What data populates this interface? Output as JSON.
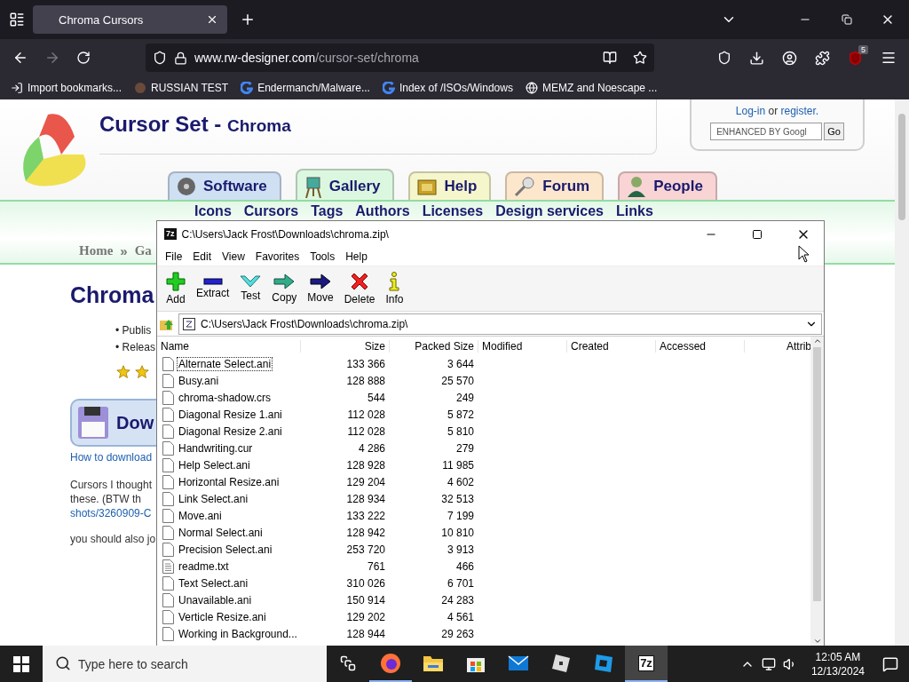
{
  "browser": {
    "tabs": [
      {
        "title": "Chroma Cursors",
        "selected": true
      }
    ],
    "url": {
      "domain": "www.rw-designer.com",
      "path": "/cursor-set/chroma"
    },
    "extensions_badge": "5",
    "bookmarks": [
      {
        "label": "Import bookmarks..."
      },
      {
        "label": "RUSSIAN TEST"
      },
      {
        "label": "Endermanch/Malware..."
      },
      {
        "label": "Index of /ISOs/Windows"
      },
      {
        "label": "MEMZ and Noescape ..."
      }
    ]
  },
  "page": {
    "site_title": "Cursor Set -",
    "site_subtitle": "Chroma",
    "login": {
      "link": "Log-in",
      "or": "or",
      "register": "register."
    },
    "search": {
      "placeholder": "ENHANCED BY Googl",
      "button": "Go"
    },
    "nav_tabs": [
      {
        "label": "Software",
        "selected": false,
        "color": "#cfe0f3"
      },
      {
        "label": "Gallery",
        "selected": true,
        "color": "#dcf7e0"
      },
      {
        "label": "Help",
        "selected": false,
        "color": "#f6f6cc"
      },
      {
        "label": "Forum",
        "selected": false,
        "color": "#fde7cc"
      },
      {
        "label": "People",
        "selected": false,
        "color": "#f8d4d4"
      }
    ],
    "sub_nav": [
      "Icons",
      "Cursors",
      "Tags",
      "Authors",
      "Licenses",
      "Design services",
      "Links"
    ],
    "breadcrumb": {
      "home": "Home",
      "separator": "»",
      "current": "Ga"
    },
    "heading": "Chroma",
    "details": [
      {
        "marker": "•",
        "text": "Publis"
      },
      {
        "marker": "•",
        "text": "Releas"
      }
    ],
    "download": "Dow",
    "how_to": "How to download",
    "description": [
      {
        "text": "Cursors I thought",
        "kind": "text"
      },
      {
        "text": "these. (BTW  th",
        "kind": "text"
      },
      {
        "text": "shots/3260909-C",
        "kind": "link"
      }
    ],
    "note": "you should also jo"
  },
  "archiver": {
    "title": "C:\\Users\\Jack Frost\\Downloads\\chroma.zip\\",
    "icon_label": "7z",
    "menu": [
      "File",
      "Edit",
      "View",
      "Favorites",
      "Tools",
      "Help"
    ],
    "toolbar": [
      "Add",
      "Extract",
      "Test",
      "Copy",
      "Move",
      "Delete",
      "Info"
    ],
    "address": "C:\\Users\\Jack Frost\\Downloads\\chroma.zip\\",
    "columns": [
      "Name",
      "Size",
      "Packed Size",
      "Modified",
      "Created",
      "Accessed",
      "Attrib"
    ],
    "rows": [
      {
        "name": "Alternate Select.ani",
        "size": "133 366",
        "packed": "3 644",
        "kind": "file",
        "focused": true
      },
      {
        "name": "Busy.ani",
        "size": "128 888",
        "packed": "25 570",
        "kind": "file",
        "focused": false
      },
      {
        "name": "chroma-shadow.crs",
        "size": "544",
        "packed": "249",
        "kind": "file",
        "focused": false
      },
      {
        "name": "Diagonal Resize 1.ani",
        "size": "112 028",
        "packed": "5 872",
        "kind": "file",
        "focused": false
      },
      {
        "name": "Diagonal Resize 2.ani",
        "size": "112 028",
        "packed": "5 810",
        "kind": "file",
        "focused": false
      },
      {
        "name": "Handwriting.cur",
        "size": "4 286",
        "packed": "279",
        "kind": "file",
        "focused": false
      },
      {
        "name": "Help Select.ani",
        "size": "128 928",
        "packed": "11 985",
        "kind": "file",
        "focused": false
      },
      {
        "name": "Horizontal Resize.ani",
        "size": "129 204",
        "packed": "4 602",
        "kind": "file",
        "focused": false
      },
      {
        "name": "Link Select.ani",
        "size": "128 934",
        "packed": "32 513",
        "kind": "file",
        "focused": false
      },
      {
        "name": "Move.ani",
        "size": "133 222",
        "packed": "7 199",
        "kind": "file",
        "focused": false
      },
      {
        "name": "Normal Select.ani",
        "size": "128 942",
        "packed": "10 810",
        "kind": "file",
        "focused": false
      },
      {
        "name": "Precision Select.ani",
        "size": "253 720",
        "packed": "3 913",
        "kind": "file",
        "focused": false
      },
      {
        "name": "readme.txt",
        "size": "761",
        "packed": "466",
        "kind": "text",
        "focused": false
      },
      {
        "name": "Text Select.ani",
        "size": "310 026",
        "packed": "6 701",
        "kind": "file",
        "focused": false
      },
      {
        "name": "Unavailable.ani",
        "size": "150 914",
        "packed": "24 283",
        "kind": "file",
        "focused": false
      },
      {
        "name": "Verticle Resize.ani",
        "size": "129 202",
        "packed": "4 561",
        "kind": "file",
        "focused": false
      },
      {
        "name": "Working in Background...",
        "size": "128 944",
        "packed": "29 263",
        "kind": "file",
        "focused": false
      }
    ]
  },
  "taskbar": {
    "search_placeholder": "Type here to search",
    "apps": [
      {
        "running": true,
        "selected": false
      },
      {
        "running": false,
        "selected": false
      },
      {
        "running": false,
        "selected": false
      },
      {
        "running": false,
        "selected": false
      },
      {
        "running": false,
        "selected": false
      },
      {
        "running": false,
        "selected": false
      },
      {
        "running": true,
        "selected": true,
        "label": "7z"
      }
    ],
    "time": "12:05 AM",
    "date": "12/13/2024"
  }
}
